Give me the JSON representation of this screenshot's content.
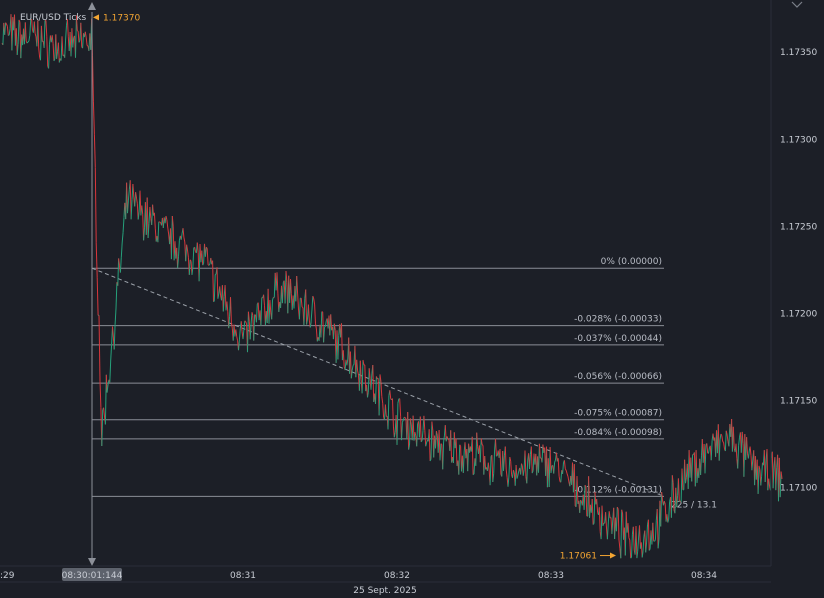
{
  "chart_data": {
    "type": "line",
    "title": "EUR/USD Ticks",
    "x": [
      "08:30:01",
      "08:30:05",
      "08:30:15",
      "08:30:30",
      "08:30:45",
      "08:31:00",
      "08:31:15",
      "08:31:30",
      "08:31:45",
      "08:32:00",
      "08:32:15",
      "08:32:30",
      "08:32:45",
      "08:33:00",
      "08:33:15",
      "08:33:30",
      "08:33:40",
      "08:33:50",
      "08:34:00",
      "08:34:10",
      "08:34:20",
      "08:34:30"
    ],
    "x_tick_labels": [
      ":29",
      "08:31",
      "08:32",
      "08:33",
      "08:34"
    ],
    "x_highlight_label": "08:30:01:144",
    "x_date_label": "25 Sept. 2025",
    "y_tick_labels": [
      "1.17350",
      "1.17300",
      "1.17250",
      "1.17200",
      "1.17150",
      "1.17100"
    ],
    "ylim": [
      1.17055,
      1.1738
    ],
    "series": [
      {
        "values": [
          1.17358,
          1.1713,
          1.17265,
          1.17245,
          1.1723,
          1.17185,
          1.17215,
          1.17195,
          1.1717,
          1.1714,
          1.17125,
          1.17118,
          1.1711,
          1.17115,
          1.1709,
          1.1707,
          1.17075,
          1.171,
          1.1712,
          1.17128,
          1.1711,
          1.17105
        ]
      }
    ],
    "pre_history": [
      1.17362,
      1.17358,
      1.1736,
      1.17356,
      1.17352,
      1.17355,
      1.17358
    ],
    "high_marker": {
      "label": "1.17370",
      "value": 1.1737
    },
    "low_marker": {
      "label": "1.17061",
      "value": 1.17061
    },
    "fib_levels": [
      {
        "label": "0% (0.00000)",
        "value": 1.17226
      },
      {
        "label": "-0.028% (-0.00033)",
        "value": 1.17193
      },
      {
        "label": "-0.037% (-0.00044)",
        "value": 1.17182
      },
      {
        "label": "-0.056% (-0.00066)",
        "value": 1.1716
      },
      {
        "label": "-0.075% (-0.00087)",
        "value": 1.17139
      },
      {
        "label": "-0.084% (-0.00098)",
        "value": 1.17128
      },
      {
        "label": "-0.112% (-0.00131)",
        "value": 1.17095
      }
    ],
    "trend_label": "225 / 13.1",
    "colors": {
      "background": "#1c1f27",
      "up": "#26a17b",
      "down": "#d8373c",
      "fib_line": "#8a8e97",
      "trend_line": "#9aa0a8",
      "marker": "#f3a532"
    }
  }
}
